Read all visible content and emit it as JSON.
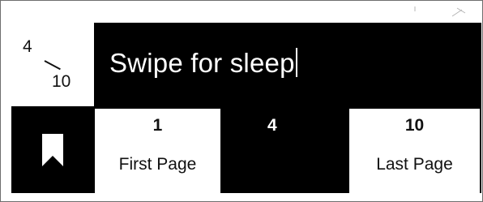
{
  "page_counter": {
    "current": "4",
    "total": "10"
  },
  "title_bar": {
    "text": "Swipe for sleep"
  },
  "navigation": {
    "bookmark_icon": "bookmark-icon",
    "first_page": {
      "number": "1",
      "label": "First Page"
    },
    "current_page": {
      "number": "4"
    },
    "last_page": {
      "number": "10",
      "label": "Last Page"
    }
  },
  "colors": {
    "background": "#ffffff",
    "bar": "#000000",
    "text_on_bar": "#ffffff"
  }
}
